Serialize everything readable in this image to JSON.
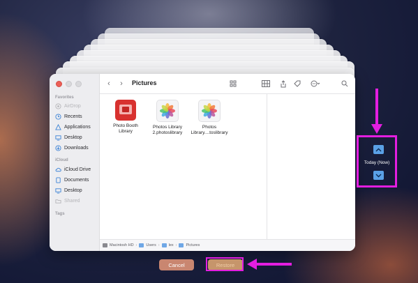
{
  "finder": {
    "title": "Pictures",
    "sidebar": {
      "favorites_label": "Favorites",
      "favorites": [
        {
          "label": "AirDrop",
          "icon": "airdrop-icon",
          "dim": true
        },
        {
          "label": "Recents",
          "icon": "clock-icon"
        },
        {
          "label": "Applications",
          "icon": "applications-icon"
        },
        {
          "label": "Desktop",
          "icon": "desktop-icon"
        },
        {
          "label": "Downloads",
          "icon": "download-icon"
        }
      ],
      "icloud_label": "iCloud",
      "icloud": [
        {
          "label": "iCloud Drive",
          "icon": "cloud-icon"
        },
        {
          "label": "Documents",
          "icon": "document-icon"
        },
        {
          "label": "Desktop",
          "icon": "desktop-icon"
        },
        {
          "label": "Shared",
          "icon": "shared-folder-icon",
          "dim": true
        }
      ],
      "tags_label": "Tags"
    },
    "files": [
      {
        "name_line1": "Photo Booth",
        "name_line2": "Library",
        "icon": "photo-booth-icon"
      },
      {
        "name_line1": "Photos Library",
        "name_line2": "2.photoslibrary",
        "icon": "photos-icon"
      },
      {
        "name_line1": "Photos",
        "name_line2": "Library....toslibrary",
        "icon": "photos-icon"
      }
    ],
    "path": [
      "Macintosh HD",
      "Users",
      "lex",
      "Pictures"
    ]
  },
  "buttons": {
    "cancel": "Cancel",
    "restore": "Restore"
  },
  "timeline": {
    "label": "Today (Now)"
  },
  "colors": {
    "highlight": "#e31ee0",
    "accent": "#5aa0e6"
  }
}
